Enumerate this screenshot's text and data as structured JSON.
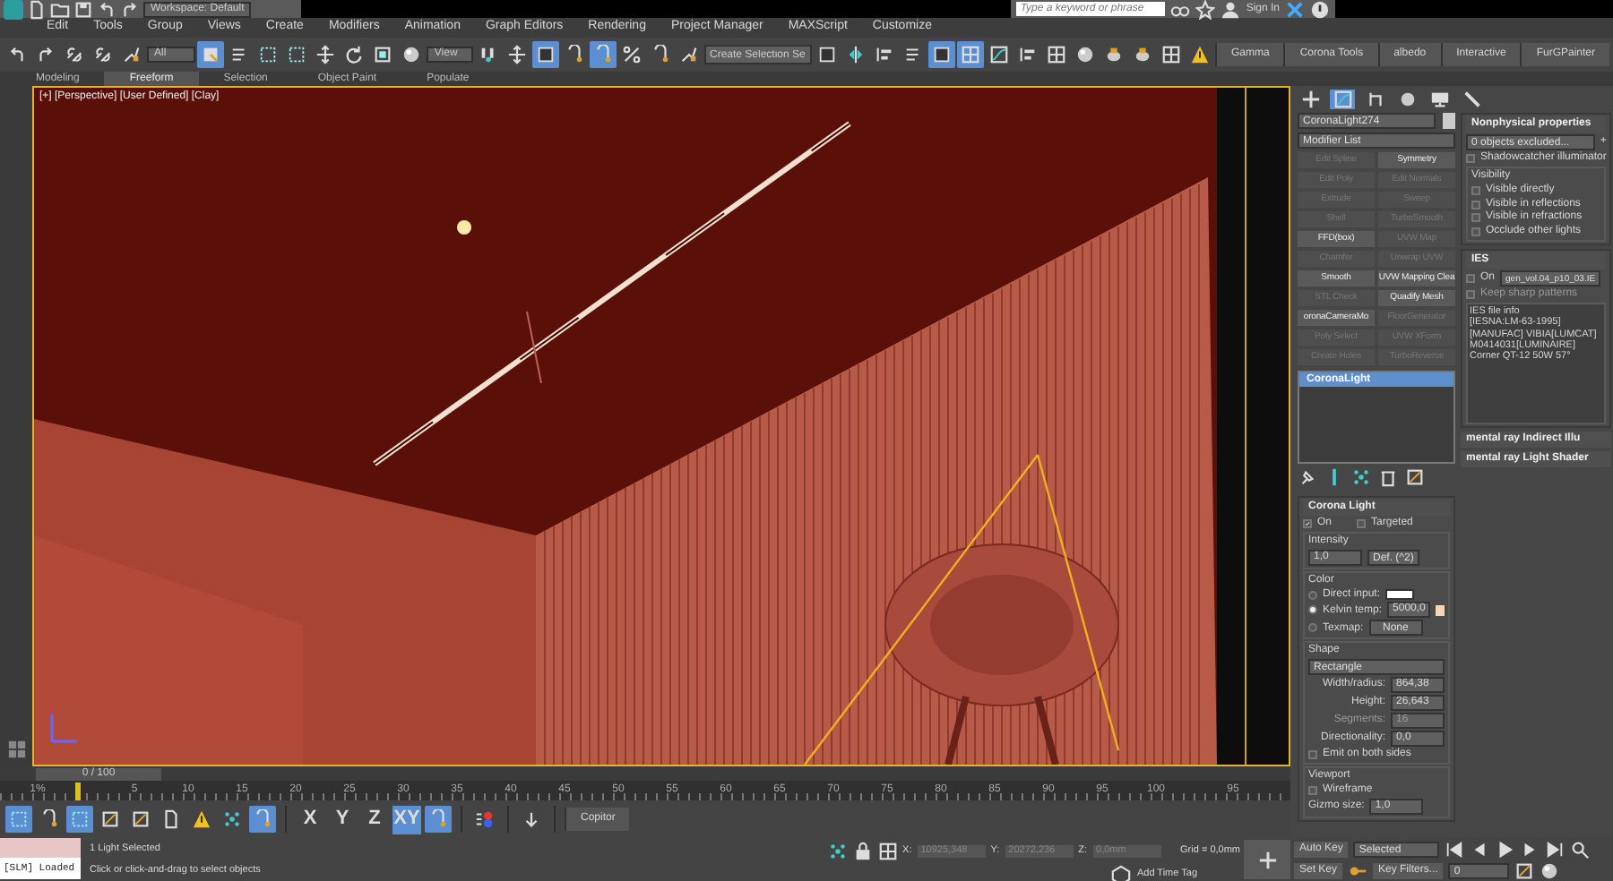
{
  "title_bar": {
    "workspace": "Workspace: Default",
    "search": {
      "placeholder": "Type a keyword or phrase"
    },
    "sign_in": "Sign In"
  },
  "menu": [
    "Edit",
    "Tools",
    "Group",
    "Views",
    "Create",
    "Modifiers",
    "Animation",
    "Graph Editors",
    "Rendering",
    "Project Manager",
    "MAXScript",
    "Customize"
  ],
  "main_toolbar": {
    "selection_filter": "All",
    "reference_coord": "View",
    "named_selection": {
      "placeholder": "Create Selection Se"
    },
    "tools": [
      {
        "active": false
      },
      {
        "active": false
      },
      {
        "active": false
      },
      {
        "active": false
      },
      {
        "active": false
      },
      {
        "active": true
      },
      {
        "active": false
      },
      {
        "active": false
      },
      {
        "active": false
      },
      {
        "active": false
      },
      {
        "active": false
      },
      {
        "active": false
      },
      {
        "active": false
      },
      {
        "active": false
      },
      {
        "active": false
      },
      {
        "active": true
      },
      {
        "active": false
      },
      {
        "active": true
      },
      {
        "active": false
      },
      {
        "active": false
      },
      {
        "active": false
      },
      {
        "active": false
      },
      {
        "active": false
      },
      {
        "active": false
      },
      {
        "active": false
      },
      {
        "active": true
      },
      {
        "active": true
      },
      {
        "active": false
      },
      {
        "active": false
      },
      {
        "active": false
      },
      {
        "active": false
      },
      {
        "active": false
      },
      {
        "active": false
      },
      {
        "active": false
      },
      {
        "active": false
      }
    ],
    "custom_tabs": [
      "Gamma",
      "Corona Tools",
      "albedo",
      "Interactive",
      "FurGPainter"
    ]
  },
  "ribbon_tabs": [
    {
      "label": "Modeling",
      "selected": false
    },
    {
      "label": "Freeform",
      "selected": true
    },
    {
      "label": "Selection",
      "selected": false
    },
    {
      "label": "Object Paint",
      "selected": false
    },
    {
      "label": "Populate",
      "selected": false
    }
  ],
  "viewport": {
    "label": "[+] [Perspective] [User Defined] [Clay]"
  },
  "command_panel": {
    "tabs": [
      {
        "selected": false
      },
      {
        "selected": true
      },
      {
        "selected": false
      },
      {
        "selected": false
      },
      {
        "selected": false
      },
      {
        "selected": false
      }
    ],
    "object_name": "CoronaLight274",
    "modifier_list": "Modifier List",
    "modifier_buttons": [
      {
        "label": "Edit Spline",
        "disabled": true
      },
      {
        "label": "Symmetry",
        "disabled": false
      },
      {
        "label": "Edit Poly",
        "disabled": true
      },
      {
        "label": "Edit Normals",
        "disabled": true
      },
      {
        "label": "Extrude",
        "disabled": true
      },
      {
        "label": "Sweep",
        "disabled": true
      },
      {
        "label": "Shell",
        "disabled": true
      },
      {
        "label": "TurboSmooth",
        "disabled": true
      },
      {
        "label": "FFD(box)",
        "disabled": false
      },
      {
        "label": "UVW Map",
        "disabled": true
      },
      {
        "label": "Chamfer",
        "disabled": true
      },
      {
        "label": "Unwrap UVW",
        "disabled": true
      },
      {
        "label": "Smooth",
        "disabled": false
      },
      {
        "label": "UVW Mapping Clea",
        "disabled": false
      },
      {
        "label": "STL Check",
        "disabled": true
      },
      {
        "label": "Quadify Mesh",
        "disabled": false
      },
      {
        "label": "oronaCameraMo",
        "disabled": false
      },
      {
        "label": "FloorGenerator",
        "disabled": true
      },
      {
        "label": "Poly Select",
        "disabled": true
      },
      {
        "label": "UVW XForm",
        "disabled": true
      },
      {
        "label": "Create Holes",
        "disabled": true
      },
      {
        "label": "TurboReverse",
        "disabled": true
      }
    ],
    "stack": [
      {
        "label": "CoronaLight",
        "selected": true
      }
    ],
    "corona_light": {
      "title": "Corona Light",
      "on": {
        "label": "On",
        "checked": true
      },
      "targeted": {
        "label": "Targeted",
        "checked": false
      },
      "intensity_label": "Intensity",
      "intensity": "1,0",
      "unit": "Def. (^2)",
      "color_label": "Color",
      "color_modes": [
        {
          "label": "Direct input:",
          "selected": false
        },
        {
          "label": "Kelvin temp:",
          "selected": true
        },
        {
          "label": "Texmap:",
          "selected": false
        }
      ],
      "kelvin": "5000,0",
      "texmap": "None",
      "shape_label": "Shape",
      "shape": "Rectangle",
      "params": [
        {
          "label": "Width/radius:",
          "value": "864,38",
          "disabled": false
        },
        {
          "label": "Height:",
          "value": "26,643",
          "disabled": false
        },
        {
          "label": "Segments:",
          "value": "16",
          "disabled": true
        },
        {
          "label": "Directionality:",
          "value": "0,0",
          "disabled": false
        }
      ],
      "emit_both": {
        "label": "Emit on both sides",
        "checked": false
      },
      "viewport_label": "Viewport",
      "wireframe": {
        "label": "Wireframe",
        "checked": false
      },
      "gizmo_label": "Gizmo size:",
      "gizmo": "1,0"
    }
  },
  "side_rollouts": {
    "nonphysical": {
      "title": "Nonphysical properties",
      "excluded": "0 objects excluded...",
      "plus": "+",
      "shadowcatcher": {
        "label": "Shadowcatcher illuminator",
        "checked": false
      },
      "visibility_label": "Visibility",
      "visibility": [
        {
          "label": "Visible directly",
          "checked": false
        },
        {
          "label": "Visible in reflections",
          "checked": false
        },
        {
          "label": "Visible in refractions",
          "checked": false
        },
        {
          "label": "Occlude other lights",
          "checked": false
        }
      ]
    },
    "ies": {
      "title": "IES",
      "on": {
        "label": "On",
        "checked": false
      },
      "file": "gen_vol.04_p10_03.IE",
      "keep_sharp": {
        "label": "Keep sharp patterns",
        "checked": false,
        "disabled": true
      },
      "info_label": "IES file info",
      "info": "[IESNA:LM-63-1995][MANUFAC] VIBIA[LUMCAT] M0414031[LUMINAIRE] Corner QT-12 50W 57°"
    },
    "collapsed": [
      "mental ray Indirect Illu",
      "mental ray Light Shader"
    ]
  },
  "timeline": {
    "frame": "0 / 100",
    "level": 0,
    "percent": "1%",
    "ticks": [
      "5",
      "10",
      "15",
      "20",
      "25",
      "30",
      "35",
      "40",
      "45",
      "50",
      "55",
      "60",
      "65",
      "70",
      "75",
      "80",
      "85",
      "90",
      "95",
      "100",
      "95"
    ]
  },
  "bottom_toolbar": {
    "tools": [
      {
        "active": true
      },
      {
        "active": false
      },
      {
        "active": true
      },
      {
        "active": false
      },
      {
        "active": false
      },
      {
        "active": false
      },
      {
        "active": false
      },
      {
        "active": false
      },
      {
        "active": true
      }
    ],
    "axes": [
      {
        "label": "X",
        "active": false
      },
      {
        "label": "Y",
        "active": false
      },
      {
        "label": "Z",
        "active": false
      },
      {
        "label": "XY",
        "active": true
      }
    ],
    "copitor": "Copitor"
  },
  "status": {
    "script_listener": "[SLM] Loaded",
    "selection": "1 Light Selected",
    "prompt": "Click or click-and-drag to select objects",
    "coords": [
      {
        "label": "X:",
        "value": "10925,348"
      },
      {
        "label": "Y:",
        "value": "20272,236"
      },
      {
        "label": "Z:",
        "value": "0,0mm"
      }
    ],
    "grid": "Grid = 0,0mm",
    "add_time_tag": "Add Time Tag"
  },
  "animation": {
    "auto_key": "Auto Key",
    "key_mode": "Selected",
    "set_key": "Set Key",
    "key_filters": "Key Filters...",
    "frame": "0"
  }
}
